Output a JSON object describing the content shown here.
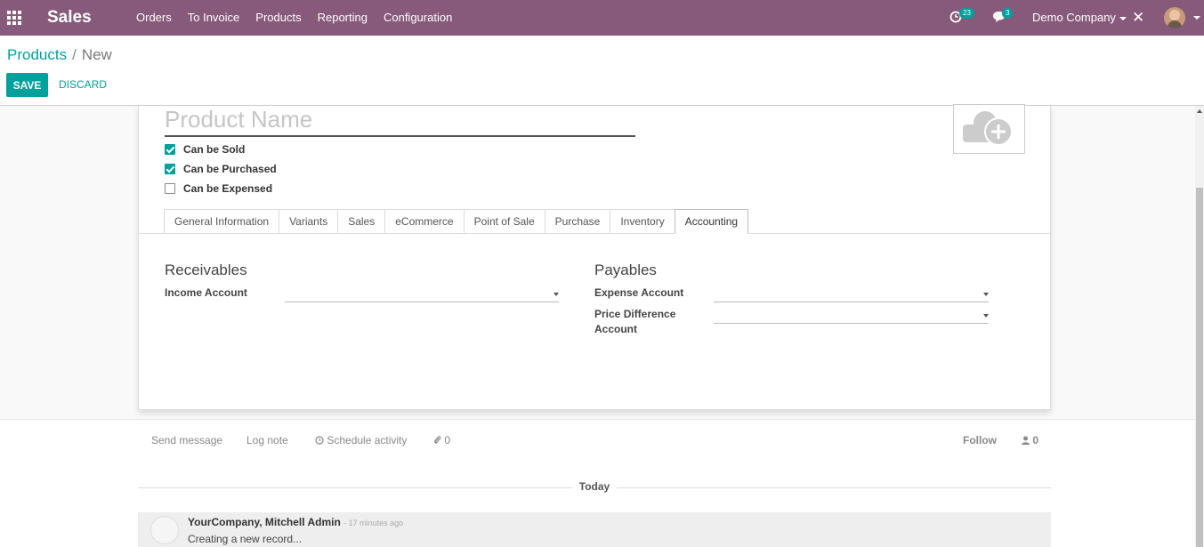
{
  "navbar": {
    "app_name": "Sales",
    "menu": [
      "Orders",
      "To Invoice",
      "Products",
      "Reporting",
      "Configuration"
    ],
    "activity_count": "23",
    "message_count": "3",
    "company": "Demo Company"
  },
  "breadcrumb": {
    "parent": "Products",
    "separator": "/",
    "current": "New"
  },
  "buttons": {
    "save": "SAVE",
    "discard": "DISCARD"
  },
  "form": {
    "name_placeholder": "Product Name",
    "checkboxes": [
      {
        "label": "Can be Sold",
        "checked": true
      },
      {
        "label": "Can be Purchased",
        "checked": true
      },
      {
        "label": "Can be Expensed",
        "checked": false
      }
    ],
    "tabs": [
      "General Information",
      "Variants",
      "Sales",
      "eCommerce",
      "Point of Sale",
      "Purchase",
      "Inventory",
      "Accounting"
    ],
    "active_tab": "Accounting",
    "receivables": {
      "title": "Receivables",
      "income_account_label": "Income Account",
      "income_account_value": ""
    },
    "payables": {
      "title": "Payables",
      "expense_account_label": "Expense Account",
      "expense_account_value": "",
      "price_difference_label_line1": "Price Difference",
      "price_difference_label_line2": "Account",
      "price_difference_value": ""
    }
  },
  "chatter": {
    "send_message": "Send message",
    "log_note": "Log note",
    "schedule_activity": "Schedule activity",
    "attachments_count": "0",
    "follow": "Follow",
    "followers_count": "0",
    "date_separator": "Today",
    "messages": [
      {
        "author": "YourCompany, Mitchell Admin",
        "time": "- 17 minutes ago",
        "body": "Creating a new record..."
      }
    ]
  },
  "colors": {
    "navbar": "#875a7b",
    "accent": "#00a09d"
  }
}
